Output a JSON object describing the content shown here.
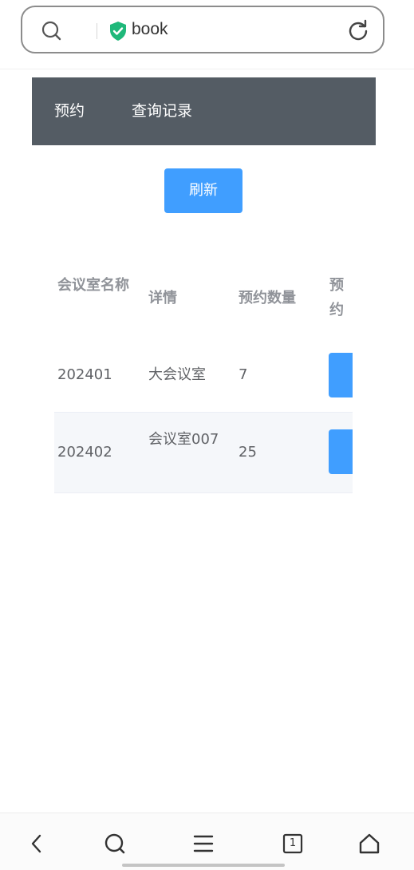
{
  "browser": {
    "url_text": "book",
    "tab_count": "1"
  },
  "nav": {
    "items": [
      "预约",
      "查询记录"
    ]
  },
  "toolbar": {
    "refresh_label": "刷新"
  },
  "table": {
    "headers": {
      "name": "会议室名称",
      "detail": "详情",
      "count": "预约数量",
      "action": "预约室"
    },
    "rows": [
      {
        "name": "202401",
        "detail": "大会议室",
        "count": "7"
      },
      {
        "name": "202402",
        "detail": "会议室007",
        "count": "25"
      }
    ]
  },
  "colors": {
    "nav_bg": "#545c64",
    "primary": "#409eff",
    "stripe": "#f5f7fa"
  },
  "icons": [
    "search-icon",
    "shield-check-icon",
    "reload-icon",
    "back-icon",
    "search-icon",
    "menu-icon",
    "tabs-icon",
    "home-icon"
  ]
}
